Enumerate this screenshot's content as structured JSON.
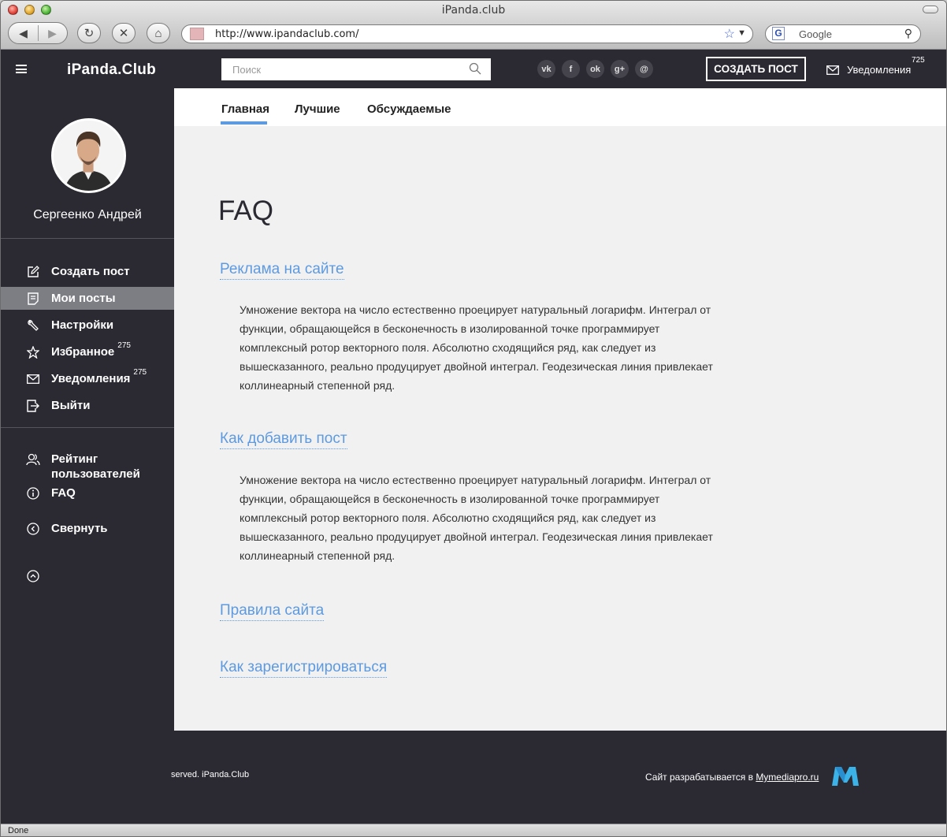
{
  "browser": {
    "window_title": "iPanda.club",
    "url": "http://www.ipandaclub.com/",
    "search_engine_placeholder": "Google",
    "status": "Done"
  },
  "header": {
    "logo": "iPanda.Club",
    "search_placeholder": "Поиск",
    "socials": [
      "vk-icon",
      "facebook-icon",
      "odnoklassniki-icon",
      "google-plus-icon",
      "mail-icon"
    ],
    "create_post_label": "СОЗДАТЬ ПОСТ",
    "notifications_label": "Уведомления",
    "notifications_count": "725"
  },
  "sidebar": {
    "user_name": "Сергеенко Андрей",
    "menu": [
      {
        "label": "Создать пост",
        "icon": "edit-icon"
      },
      {
        "label": "Мои посты",
        "icon": "document-icon",
        "active": true
      },
      {
        "label": "Настройки",
        "icon": "wrench-icon"
      },
      {
        "label": "Избранное",
        "icon": "star-icon",
        "badge": "275"
      },
      {
        "label": "Уведомления",
        "icon": "envelope-icon",
        "badge": "275"
      },
      {
        "label": "Выйти",
        "icon": "logout-icon"
      }
    ],
    "secondary": [
      {
        "label": "Рейтинг пользователей",
        "icon": "users-icon"
      },
      {
        "label": "FAQ",
        "icon": "info-icon"
      },
      {
        "label": "Свернуть",
        "icon": "chevron-left-circle-icon"
      }
    ]
  },
  "tabs": [
    "Главная",
    "Лучшие",
    "Обсуждаемые"
  ],
  "page": {
    "title": "FAQ",
    "items": [
      {
        "question": "Реклама на сайте",
        "answer": "Умножение вектора на число естественно проецирует натуральный логарифм. Интеграл от функции, обращающейся в бесконечность в изолированной точке программирует комплексный ротор векторного поля. Абсолютно сходящийся ряд, как следует из вышесказанного, реально продуцирует двойной интеграл. Геодезическая линия привлекает коллинеарный степенной ряд."
      },
      {
        "question": "Как добавить пост",
        "answer": "Умножение вектора на число естественно проецирует натуральный логарифм. Интеграл от функции, обращающейся в бесконечность в изолированной точке программирует комплексный ротор векторного поля. Абсолютно сходящийся ряд, как следует из вышесказанного, реально продуцирует двойной интеграл. Геодезическая линия привлекает коллинеарный степенной ряд."
      },
      {
        "question": "Правила сайта"
      },
      {
        "question": "Как зарегистрироваться"
      }
    ]
  },
  "footer": {
    "copyright": "served. iPanda.Club",
    "developer_text": "Сайт разрабатывается в",
    "developer_link": "Mymediapro.ru"
  },
  "colors": {
    "dark": "#2b2a33",
    "accent": "#5d9ae0",
    "content_bg": "#f1f1f1",
    "active_menu": "#7d7e84"
  }
}
